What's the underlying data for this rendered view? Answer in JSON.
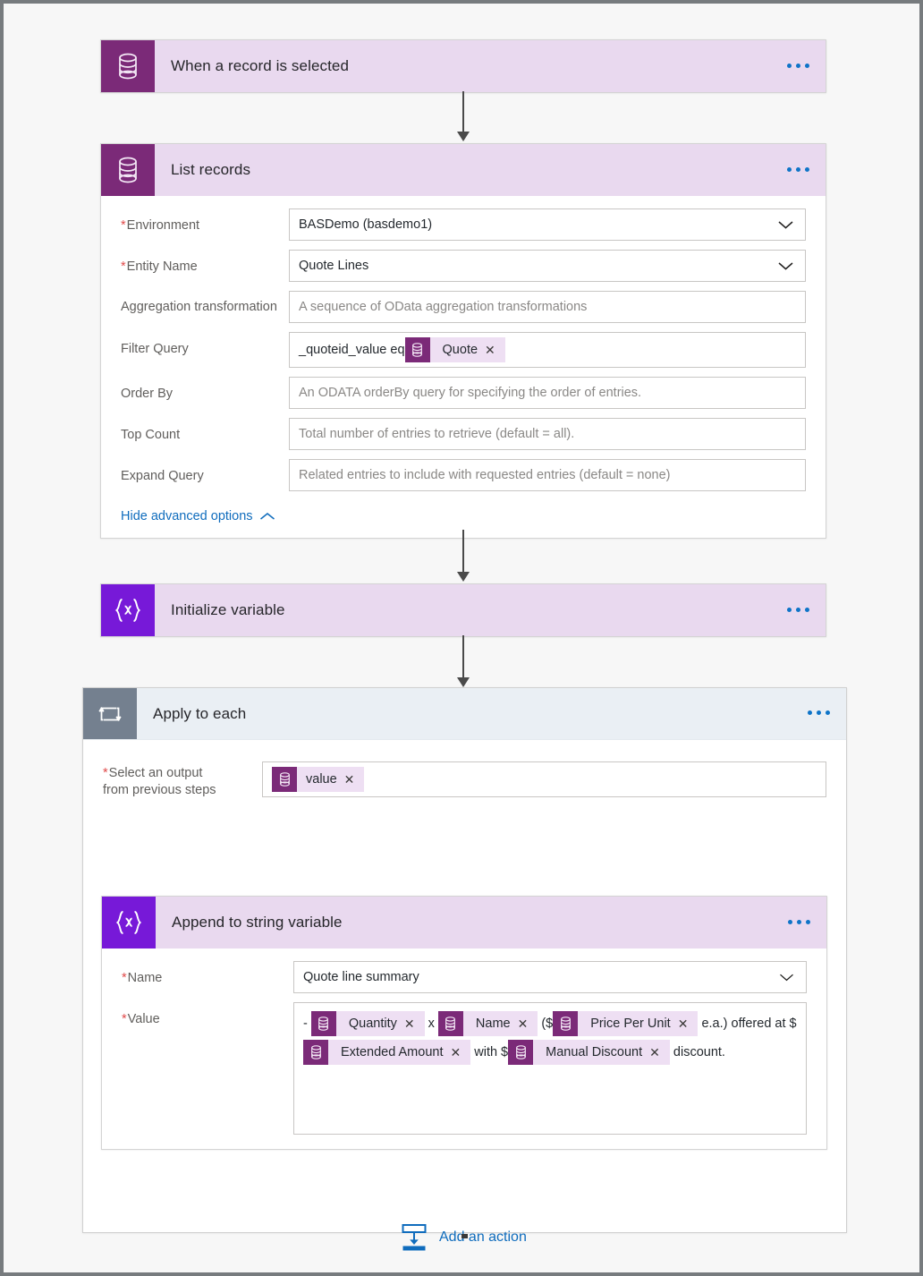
{
  "flow": {
    "trigger": {
      "title": "When a record is selected",
      "icon": "dataverse-database-icon",
      "menu": "more-commands"
    },
    "list_records": {
      "title": "List records",
      "icon": "dataverse-database-icon",
      "fields": [
        {
          "label": "Environment",
          "required": true,
          "type": "select",
          "value": "BASDemo (basdemo1)",
          "placeholder": ""
        },
        {
          "label": "Entity Name",
          "required": true,
          "type": "select",
          "value": "Quote Lines",
          "placeholder": ""
        },
        {
          "label": "Aggregation transformation",
          "required": false,
          "type": "text",
          "value": "",
          "placeholder": "A sequence of OData aggregation transformations"
        },
        {
          "label": "Filter Query",
          "required": false,
          "type": "token",
          "value": "_quoteid_value eq ",
          "token": "Quote",
          "placeholder": ""
        },
        {
          "label": "Order By",
          "required": false,
          "type": "text",
          "value": "",
          "placeholder": "An ODATA orderBy query for specifying the order of entries."
        },
        {
          "label": "Top Count",
          "required": false,
          "type": "text",
          "value": "",
          "placeholder": "Total number of entries to retrieve (default = all)."
        },
        {
          "label": "Expand Query",
          "required": false,
          "type": "text",
          "value": "",
          "placeholder": "Related entries to include with requested entries (default = none)"
        }
      ],
      "advanced_link": "Hide advanced options"
    },
    "initialize_variable": {
      "title": "Initialize variable",
      "icon": "variable-braces-icon"
    },
    "apply_to_each": {
      "title": "Apply to each",
      "icon": "loop-repeat-icon",
      "output_label_line1": "Select an output",
      "output_label_line2": "from previous steps",
      "output_token": "value"
    },
    "append_to_string": {
      "title": "Append to string variable",
      "icon": "variable-braces-icon",
      "name_label": "Name",
      "name_value": "Quote line summary",
      "value_label": "Value",
      "value_parts": [
        {
          "kind": "text",
          "text": "- "
        },
        {
          "kind": "token",
          "text": "Quantity"
        },
        {
          "kind": "text",
          "text": " x "
        },
        {
          "kind": "token",
          "text": "Name"
        },
        {
          "kind": "text",
          "text": " ($"
        },
        {
          "kind": "token",
          "text": "Price Per Unit"
        },
        {
          "kind": "text",
          "text": " e.a.) offered at $"
        },
        {
          "kind": "token",
          "text": "Extended Amount"
        },
        {
          "kind": "text",
          "text": " with $"
        },
        {
          "kind": "token",
          "text": "Manual Discount"
        },
        {
          "kind": "text",
          "text": " discount."
        }
      ]
    },
    "add_action": {
      "label": "Add an action",
      "icon": "insert-action-icon"
    }
  },
  "colors": {
    "dataverse_purple": "#7b2a78",
    "variable_violet": "#7719d8",
    "loop_slate": "#74808f",
    "header_lavender": "#e9d9ef",
    "header_gray": "#eaeff4",
    "token_bg": "#eedff3",
    "link_blue": "#0f6cbd",
    "required_red": "#e04a4a"
  }
}
